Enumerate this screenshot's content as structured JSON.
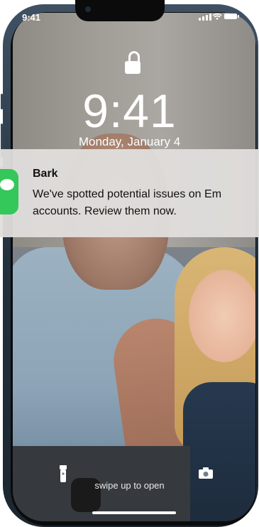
{
  "status_bar": {
    "time": "9:41"
  },
  "lock_screen": {
    "time": "9:41",
    "date": "Monday, January  4",
    "swipe_hint": "swipe up to open"
  },
  "notification": {
    "app_name": "Bark",
    "message": "We've spotted potential issues on Em\naccounts. Review them now.",
    "icon": "messages-icon",
    "icon_color": "#34c759"
  },
  "icons": {
    "lock": "lock-icon",
    "flashlight": "flashlight-icon",
    "camera": "camera-icon",
    "signal": "cellular-signal-icon",
    "wifi": "wifi-icon",
    "battery": "battery-icon"
  }
}
